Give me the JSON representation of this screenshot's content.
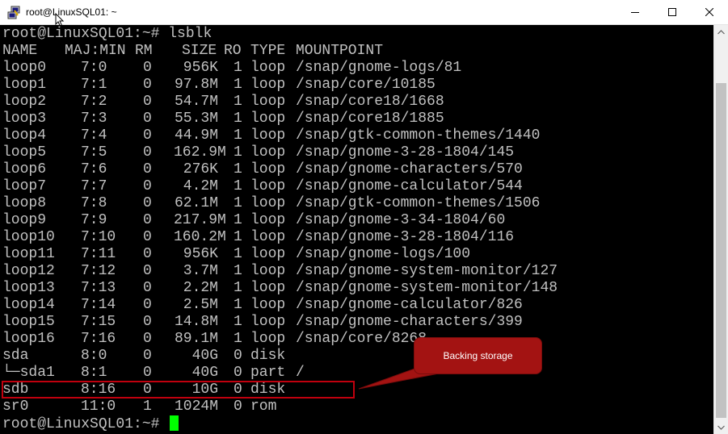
{
  "window": {
    "title": "root@LinuxSQL01: ~",
    "icon": "putty-icon",
    "controls": {
      "minimize": "minimize-icon",
      "maximize": "maximize-icon",
      "close": "close-icon"
    }
  },
  "terminal": {
    "command_prompt": "root@LinuxSQL01:~# lsblk",
    "headers": [
      "NAME",
      "MAJ:MIN",
      "RM",
      "SIZE",
      "RO",
      "TYPE",
      "MOUNTPOINT"
    ],
    "rows": [
      {
        "name": "loop0",
        "majmin": "7:0",
        "rm": "0",
        "size": "956K",
        "ro": "1",
        "type": "loop",
        "mount": "/snap/gnome-logs/81"
      },
      {
        "name": "loop1",
        "majmin": "7:1",
        "rm": "0",
        "size": "97.8M",
        "ro": "1",
        "type": "loop",
        "mount": "/snap/core/10185"
      },
      {
        "name": "loop2",
        "majmin": "7:2",
        "rm": "0",
        "size": "54.7M",
        "ro": "1",
        "type": "loop",
        "mount": "/snap/core18/1668"
      },
      {
        "name": "loop3",
        "majmin": "7:3",
        "rm": "0",
        "size": "55.3M",
        "ro": "1",
        "type": "loop",
        "mount": "/snap/core18/1885"
      },
      {
        "name": "loop4",
        "majmin": "7:4",
        "rm": "0",
        "size": "44.9M",
        "ro": "1",
        "type": "loop",
        "mount": "/snap/gtk-common-themes/1440"
      },
      {
        "name": "loop5",
        "majmin": "7:5",
        "rm": "0",
        "size": "162.9M",
        "ro": "1",
        "type": "loop",
        "mount": "/snap/gnome-3-28-1804/145"
      },
      {
        "name": "loop6",
        "majmin": "7:6",
        "rm": "0",
        "size": "276K",
        "ro": "1",
        "type": "loop",
        "mount": "/snap/gnome-characters/570"
      },
      {
        "name": "loop7",
        "majmin": "7:7",
        "rm": "0",
        "size": "4.2M",
        "ro": "1",
        "type": "loop",
        "mount": "/snap/gnome-calculator/544"
      },
      {
        "name": "loop8",
        "majmin": "7:8",
        "rm": "0",
        "size": "62.1M",
        "ro": "1",
        "type": "loop",
        "mount": "/snap/gtk-common-themes/1506"
      },
      {
        "name": "loop9",
        "majmin": "7:9",
        "rm": "0",
        "size": "217.9M",
        "ro": "1",
        "type": "loop",
        "mount": "/snap/gnome-3-34-1804/60"
      },
      {
        "name": "loop10",
        "majmin": "7:10",
        "rm": "0",
        "size": "160.2M",
        "ro": "1",
        "type": "loop",
        "mount": "/snap/gnome-3-28-1804/116"
      },
      {
        "name": "loop11",
        "majmin": "7:11",
        "rm": "0",
        "size": "956K",
        "ro": "1",
        "type": "loop",
        "mount": "/snap/gnome-logs/100"
      },
      {
        "name": "loop12",
        "majmin": "7:12",
        "rm": "0",
        "size": "3.7M",
        "ro": "1",
        "type": "loop",
        "mount": "/snap/gnome-system-monitor/127"
      },
      {
        "name": "loop13",
        "majmin": "7:13",
        "rm": "0",
        "size": "2.2M",
        "ro": "1",
        "type": "loop",
        "mount": "/snap/gnome-system-monitor/148"
      },
      {
        "name": "loop14",
        "majmin": "7:14",
        "rm": "0",
        "size": "2.5M",
        "ro": "1",
        "type": "loop",
        "mount": "/snap/gnome-calculator/826"
      },
      {
        "name": "loop15",
        "majmin": "7:15",
        "rm": "0",
        "size": "14.8M",
        "ro": "1",
        "type": "loop",
        "mount": "/snap/gnome-characters/399"
      },
      {
        "name": "loop16",
        "majmin": "7:16",
        "rm": "0",
        "size": "89.1M",
        "ro": "1",
        "type": "loop",
        "mount": "/snap/core/8268"
      },
      {
        "name": "sda",
        "majmin": "8:0",
        "rm": "0",
        "size": "40G",
        "ro": "0",
        "type": "disk",
        "mount": ""
      },
      {
        "name": "└─sda1",
        "majmin": "8:1",
        "rm": "0",
        "size": "40G",
        "ro": "0",
        "type": "part",
        "mount": "/"
      },
      {
        "name": "sdb",
        "majmin": "8:16",
        "rm": "0",
        "size": "10G",
        "ro": "0",
        "type": "disk",
        "mount": ""
      },
      {
        "name": "sr0",
        "majmin": "11:0",
        "rm": "1",
        "size": "1024M",
        "ro": "0",
        "type": "rom",
        "mount": ""
      }
    ],
    "final_prompt": "root@LinuxSQL01:~#",
    "cursor_color": "#00ff00"
  },
  "annotation": {
    "callout_text": "Backing storage",
    "highlighted_row": "sdb",
    "color": "#a31312"
  }
}
